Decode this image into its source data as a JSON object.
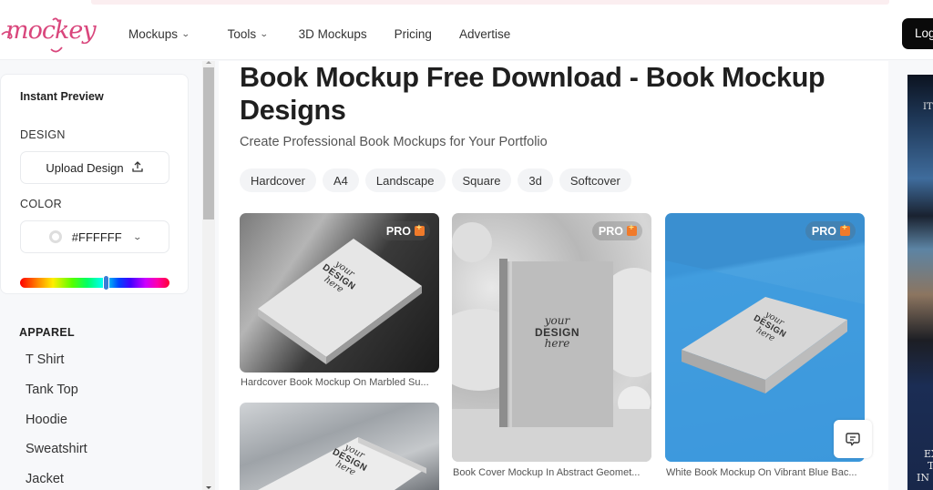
{
  "brand": {
    "name": "mockey",
    "color": "#d9467c"
  },
  "nav": {
    "items": [
      {
        "label": "Mockups",
        "has_dropdown": true
      },
      {
        "label": "Tools",
        "has_dropdown": true
      },
      {
        "label": "3D Mockups",
        "has_dropdown": false
      },
      {
        "label": "Pricing",
        "has_dropdown": false
      },
      {
        "label": "Advertise",
        "has_dropdown": false
      }
    ],
    "login_label": "Log"
  },
  "sidebar": {
    "preview_title": "Instant Preview",
    "design_label": "DESIGN",
    "upload_label": "Upload Design",
    "upload_icon": "upload-icon",
    "color_label": "COLOR",
    "color_value": "#FFFFFF",
    "hue_position_percent": 58,
    "apparel_label": "APPAREL",
    "apparel_items": [
      "T Shirt",
      "Tank Top",
      "Hoodie",
      "Sweatshirt",
      "Jacket"
    ]
  },
  "main": {
    "title": "Book Mockup Free Download - Book Mockup Designs",
    "subtitle": "Create Professional Book Mockups for Your Portfolio",
    "tags": [
      "Hardcover",
      "A4",
      "Landscape",
      "Square",
      "3d",
      "Softcover"
    ],
    "cards": [
      {
        "caption": "Hardcover Book Mockup On Marbled Su...",
        "badge": "PRO",
        "book_text": [
          "your",
          "DESIGN",
          "here"
        ]
      },
      {
        "caption": "Book Cover Mockup In Abstract Geomet...",
        "badge": "PRO",
        "book_text": [
          "your",
          "DESIGN",
          "here"
        ]
      },
      {
        "caption": "White Book Mockup On Vibrant Blue Bac...",
        "badge": "PRO",
        "book_text": [
          "your",
          "DESIGN",
          "here"
        ]
      },
      {
        "caption": "",
        "badge": "",
        "book_text": [
          "your",
          "DESIGN",
          "here"
        ]
      }
    ]
  },
  "chat": {
    "icon": "chat-icon"
  },
  "ad": {
    "lines": [
      "ITO",
      "EX",
      "T",
      "IN"
    ]
  }
}
